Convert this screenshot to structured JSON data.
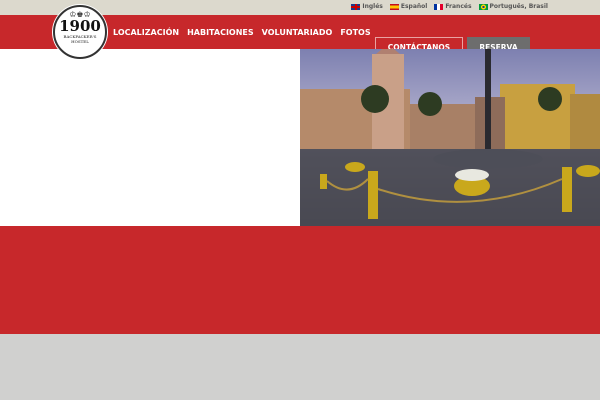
{
  "languages": [
    {
      "label": "Inglés",
      "flag": "uk-flag-icon"
    },
    {
      "label": "Español",
      "flag": "spain-flag-icon"
    },
    {
      "label": "Francés",
      "flag": "france-flag-icon"
    },
    {
      "label": "Português, Brasil",
      "flag": "brazil-flag-icon"
    }
  ],
  "logo": {
    "number": "1900",
    "line1": "BACKPACKER'S",
    "line2": "HOSTEL"
  },
  "nav": [
    "LOCALIZACIÓN",
    "HABITACIONES",
    "VOLUNTARIADO",
    "FOTOS"
  ],
  "buttons": {
    "contact": "CONTÁCTANOS",
    "reserve": "RESERVA"
  },
  "colors": {
    "brand_red": "#c7282b",
    "top_bar": "#dcd9cd",
    "reserve_gray": "#6d6d6d"
  }
}
